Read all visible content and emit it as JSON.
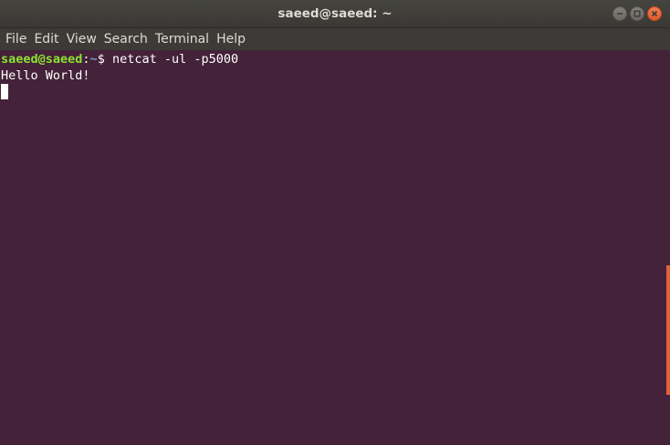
{
  "window": {
    "title": "saeed@saeed: ~"
  },
  "menu": {
    "items": [
      "File",
      "Edit",
      "View",
      "Search",
      "Terminal",
      "Help"
    ]
  },
  "terminal": {
    "prompt_user_host": "saeed@saeed",
    "prompt_colon": ":",
    "prompt_path": "~",
    "prompt_symbol": "$ ",
    "command": "netcat -ul -p5000",
    "output_line": "Hello World!"
  },
  "colors": {
    "terminal_background": "#442239",
    "prompt_user": "#8ae234",
    "prompt_path": "#729fcf",
    "close_button": "#e05a2a",
    "scrollbar_thumb": "#e0623a"
  },
  "icons": {
    "minimize": "minimize-icon",
    "maximize": "maximize-icon",
    "close": "close-icon"
  }
}
